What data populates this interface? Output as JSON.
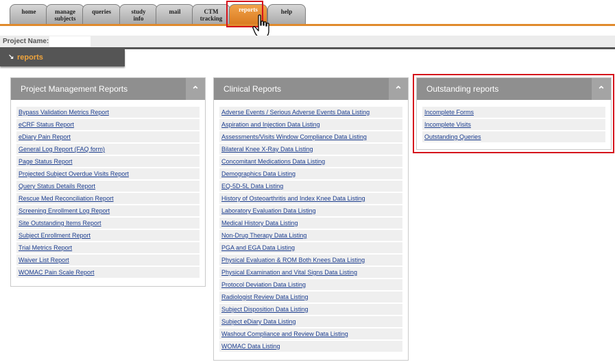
{
  "nav": {
    "tabs": [
      {
        "line1": "home",
        "line2": ""
      },
      {
        "line1": "manage",
        "line2": "subjects"
      },
      {
        "line1": "queries",
        "line2": ""
      },
      {
        "line1": "study",
        "line2": "info"
      },
      {
        "line1": "mail",
        "line2": ""
      },
      {
        "line1": "CTM",
        "line2": "tracking"
      },
      {
        "line1": "reports",
        "line2": ""
      },
      {
        "line1": "help",
        "line2": ""
      }
    ],
    "active_tab": "reports",
    "accent_color": "#e08a2c",
    "highlight_color": "#d5121b"
  },
  "project": {
    "label": "Project Name:",
    "value": ""
  },
  "section": {
    "arrow": "↘",
    "title": "reports"
  },
  "panels": {
    "project_management": {
      "title": "Project Management Reports",
      "toggle": "⌃",
      "items": [
        "Bypass Validation Metrics Report",
        "eCRF Status Report",
        "eDiary Pain Report",
        "General Log Report (FAQ form)",
        "Page Status Report",
        "Projected Subject Overdue Visits Report",
        "Query Status Details Report",
        "Rescue Med Reconciliation Report",
        "Screening Enrollment Log Report",
        "Site Outstanding Items Report",
        "Subject Enrollment Report",
        "Trial Metrics Report",
        "Waiver List Report",
        "WOMAC Pain Scale Report"
      ]
    },
    "clinical": {
      "title": "Clinical Reports",
      "toggle": "⌃",
      "items": [
        "Adverse Events / Serious Adverse Events Data Listing",
        "Aspiration and Injection Data Listing",
        "Assessments/Visits Window Compliance Data Listing",
        "Bilateral Knee X-Ray Data Listing",
        "Concomitant Medications Data Listing",
        "Demographics Data Listing",
        "EQ-5D-5L Data Listing",
        "History of Osteoarthritis and Index Knee Data Listing",
        "Laboratory Evaluation Data Listing",
        "Medical History Data Listing",
        "Non-Drug Therapy Data Listing",
        "PGA and EGA Data Listing",
        "Physical Evaluation & ROM Both Knees Data Listing",
        "Physical Examination and Vital Signs Data Listing",
        "Protocol Deviation Data Listing",
        "Radiologist Review Data Listing",
        "Subject Disposition Data Listing",
        "Subject eDiary Data Listing",
        "Washout Compliance and Review Data Listing",
        "WOMAC Data Listing"
      ]
    },
    "outstanding": {
      "title": "Outstanding reports",
      "toggle": "⌃",
      "items": [
        "Incomplete Forms",
        "Incomplete Visits",
        "Outstanding Queries"
      ]
    }
  }
}
